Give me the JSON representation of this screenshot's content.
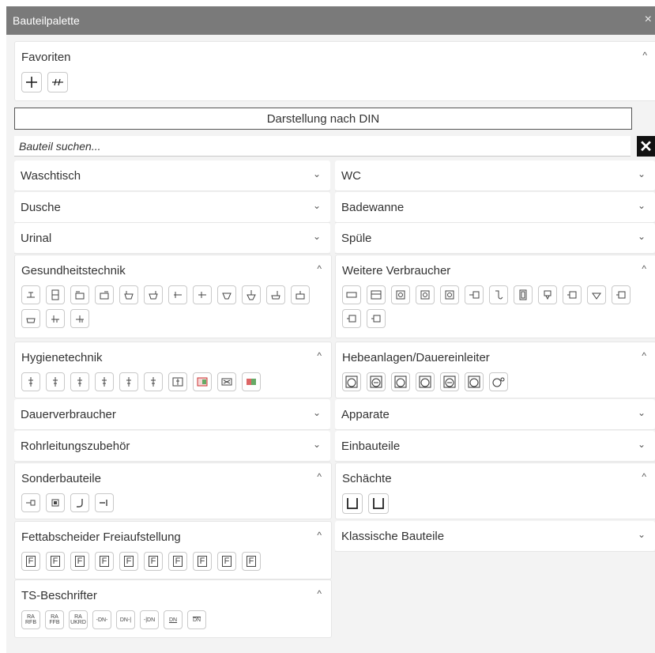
{
  "window": {
    "title": "Bauteilpalette",
    "close_glyph": "×"
  },
  "favorites": {
    "title": "Favoriten",
    "chevron": "^"
  },
  "mode_button": "Darstellung nach DIN",
  "search": {
    "placeholder": "Bauteil suchen...",
    "value": "",
    "clear_glyph": "✕"
  },
  "sections": {
    "waschtisch": {
      "title": "Waschtisch",
      "chevron": "⌄"
    },
    "wc": {
      "title": "WC",
      "chevron": "⌄"
    },
    "dusche": {
      "title": "Dusche",
      "chevron": "⌄"
    },
    "badewanne": {
      "title": "Badewanne",
      "chevron": "⌄"
    },
    "urinal": {
      "title": "Urinal",
      "chevron": "⌄"
    },
    "spuele": {
      "title": "Spüle",
      "chevron": "⌄"
    },
    "gesundheit": {
      "title": "Gesundheitstechnik",
      "chevron": "^"
    },
    "weitere": {
      "title": "Weitere Verbraucher",
      "chevron": "^"
    },
    "hygiene": {
      "title": "Hygienetechnik",
      "chevron": "^"
    },
    "hebe": {
      "title": "Hebeanlagen/Dauereinleiter",
      "chevron": "^"
    },
    "dauer": {
      "title": "Dauerverbraucher",
      "chevron": "⌄"
    },
    "apparate": {
      "title": "Apparate",
      "chevron": "⌄"
    },
    "rohr": {
      "title": "Rohrleitungszubehör",
      "chevron": "⌄"
    },
    "einbau": {
      "title": "Einbauteile",
      "chevron": "⌄"
    },
    "sonder": {
      "title": "Sonderbauteile",
      "chevron": "^"
    },
    "schaechte": {
      "title": "Schächte",
      "chevron": "^"
    },
    "fett": {
      "title": "Fettabscheider Freiaufstellung",
      "chevron": "^"
    },
    "klassisch": {
      "title": "Klassische Bauteile",
      "chevron": "⌄"
    },
    "ts": {
      "title": "TS-Beschrifter",
      "chevron": "^"
    }
  },
  "ts_labels": {
    "ra_rfb": "RA RFB",
    "ra_ffb": "RA FFB",
    "ra_ukrd": "RA UKRD",
    "dn1": "-DN-",
    "dn2": "DN-|",
    "dn3": "-|DN",
    "dn4": "DN",
    "dn5": "DN"
  },
  "fett_label": "F",
  "icons": {
    "favorites": [
      "cross-fitting-icon",
      "pipe-break-icon"
    ],
    "gesundheit": [
      "fixture-icon",
      "fixture-icon",
      "fixture-icon",
      "fixture-icon",
      "fixture-icon",
      "fixture-icon",
      "fixture-icon",
      "fixture-icon",
      "fixture-icon",
      "fixture-icon",
      "fixture-icon",
      "fixture-icon",
      "fixture-icon",
      "fixture-icon",
      "fixture-icon"
    ],
    "weitere": [
      "consumer-icon",
      "consumer-icon",
      "consumer-icon",
      "consumer-icon",
      "consumer-icon",
      "consumer-icon",
      "consumer-icon",
      "consumer-icon",
      "consumer-icon",
      "consumer-icon",
      "consumer-icon",
      "consumer-icon",
      "consumer-icon",
      "consumer-icon"
    ],
    "hygiene": [
      "hygiene-icon",
      "hygiene-icon",
      "hygiene-icon",
      "hygiene-icon",
      "hygiene-icon",
      "hygiene-icon",
      "hygiene-icon",
      "hygiene-icon",
      "hygiene-icon",
      "hygiene-icon"
    ],
    "hebe": [
      "lifting-plant-icon",
      "lifting-plant-icon",
      "lifting-plant-icon",
      "lifting-plant-icon",
      "lifting-plant-icon",
      "lifting-plant-icon",
      "lifting-plant-icon"
    ],
    "sonder": [
      "special-part-icon",
      "special-part-icon",
      "special-part-icon",
      "special-part-icon"
    ],
    "schaechte": [
      "shaft-icon",
      "shaft-icon"
    ]
  }
}
